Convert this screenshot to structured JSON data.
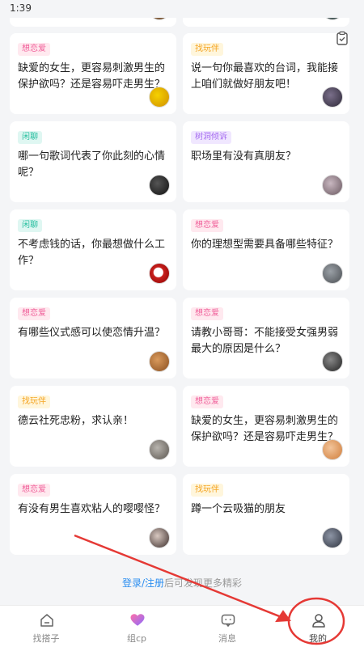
{
  "status_bar": {
    "time": "1:39"
  },
  "cards": [
    {
      "tag": "",
      "question": "",
      "avatar": "person"
    },
    {
      "tag": "",
      "question": "",
      "avatar": "person"
    },
    {
      "tag": "想恋爱",
      "tag_color": "pink",
      "question": "缺爱的女生，更容易刺激男生的保护欲吗？还是容易吓走男生？",
      "avatar": "person"
    },
    {
      "tag": "找玩伴",
      "tag_color": "yellow",
      "question": "说一句你最喜欢的台词，我能接上咱们就做好朋友吧！",
      "avatar": "person"
    },
    {
      "tag": "闲聊",
      "tag_color": "teal",
      "question": "哪一句歌词代表了你此刻的心情呢？",
      "avatar": "person"
    },
    {
      "tag": "树洞倾诉",
      "tag_color": "purple",
      "question": "职场里有没有真朋友？",
      "avatar": "person"
    },
    {
      "tag": "闲聊",
      "tag_color": "teal",
      "question": "不考虑钱的话，你最想做什么工作？",
      "avatar": "person"
    },
    {
      "tag": "想恋爱",
      "tag_color": "pink",
      "question": "你的理想型需要具备哪些特征？",
      "avatar": "person"
    },
    {
      "tag": "想恋爱",
      "tag_color": "pink",
      "question": "有哪些仪式感可以使恋情升温？",
      "avatar": "person"
    },
    {
      "tag": "想恋爱",
      "tag_color": "pink",
      "question": "请教小哥哥：不能接受女强男弱最大的原因是什么？",
      "avatar": "person"
    },
    {
      "tag": "找玩伴",
      "tag_color": "yellow",
      "question": "德云社死忠粉，求认亲！",
      "avatar": "person"
    },
    {
      "tag": "想恋爱",
      "tag_color": "pink",
      "question": "缺爱的女生，更容易刺激男生的保护欲吗？还是容易吓走男生？",
      "avatar": "person"
    },
    {
      "tag": "想恋爱",
      "tag_color": "pink",
      "question": "有没有男生喜欢粘人的嘤嘤怪？",
      "avatar": "person"
    },
    {
      "tag": "找玩伴",
      "tag_color": "yellow",
      "question": "蹲一个云吸猫的朋友",
      "avatar": "person"
    }
  ],
  "login_hint": {
    "login": "登录",
    "slash": "/",
    "register": "注册",
    "rest": "后可发现更多精彩"
  },
  "tab_bar": {
    "tabs": [
      {
        "label": "找搭子",
        "icon": "home-icon"
      },
      {
        "label": "组cp",
        "icon": "heart-icon"
      },
      {
        "label": "消息",
        "icon": "chat-icon"
      },
      {
        "label": "我的",
        "icon": "user-icon"
      }
    ]
  },
  "colors": {
    "background": "#f4f5f7",
    "link": "#2b8ef0",
    "annotation": "#e53935",
    "tag_pink": "#f0609a",
    "tag_yellow": "#f5a524",
    "tag_teal": "#29bfa0",
    "tag_purple": "#a66cf0"
  }
}
